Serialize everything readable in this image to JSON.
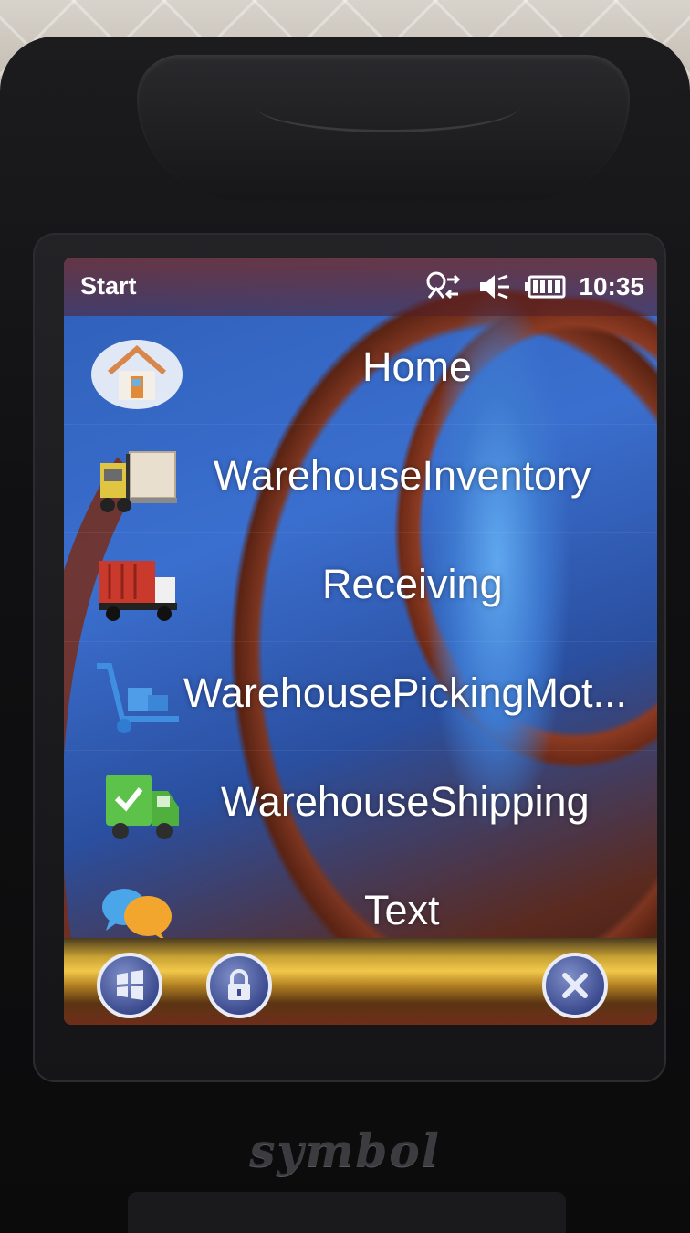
{
  "statusbar": {
    "title": "Start",
    "time": "10:35",
    "icons": [
      "connectivity-icon",
      "volume-muted-icon",
      "battery-icon"
    ]
  },
  "menu": {
    "items": [
      {
        "label": "Home",
        "icon": "home-icon"
      },
      {
        "label": "WarehouseInventory",
        "icon": "forklift-icon"
      },
      {
        "label": "Receiving",
        "icon": "delivery-truck-icon"
      },
      {
        "label": "WarehousePickingMot...",
        "icon": "hand-truck-icon"
      },
      {
        "label": "WarehouseShipping",
        "icon": "shipping-truck-icon"
      },
      {
        "label": "Text",
        "icon": "chat-bubbles-icon"
      }
    ]
  },
  "taskbar": {
    "buttons": [
      "windows-start-icon",
      "lock-icon",
      "close-icon"
    ]
  },
  "device": {
    "brand": "symbol"
  },
  "colors": {
    "taskbar_gold": "#f2c84a",
    "button_blue": "#3c4b8f",
    "text_white": "#ffffff"
  }
}
